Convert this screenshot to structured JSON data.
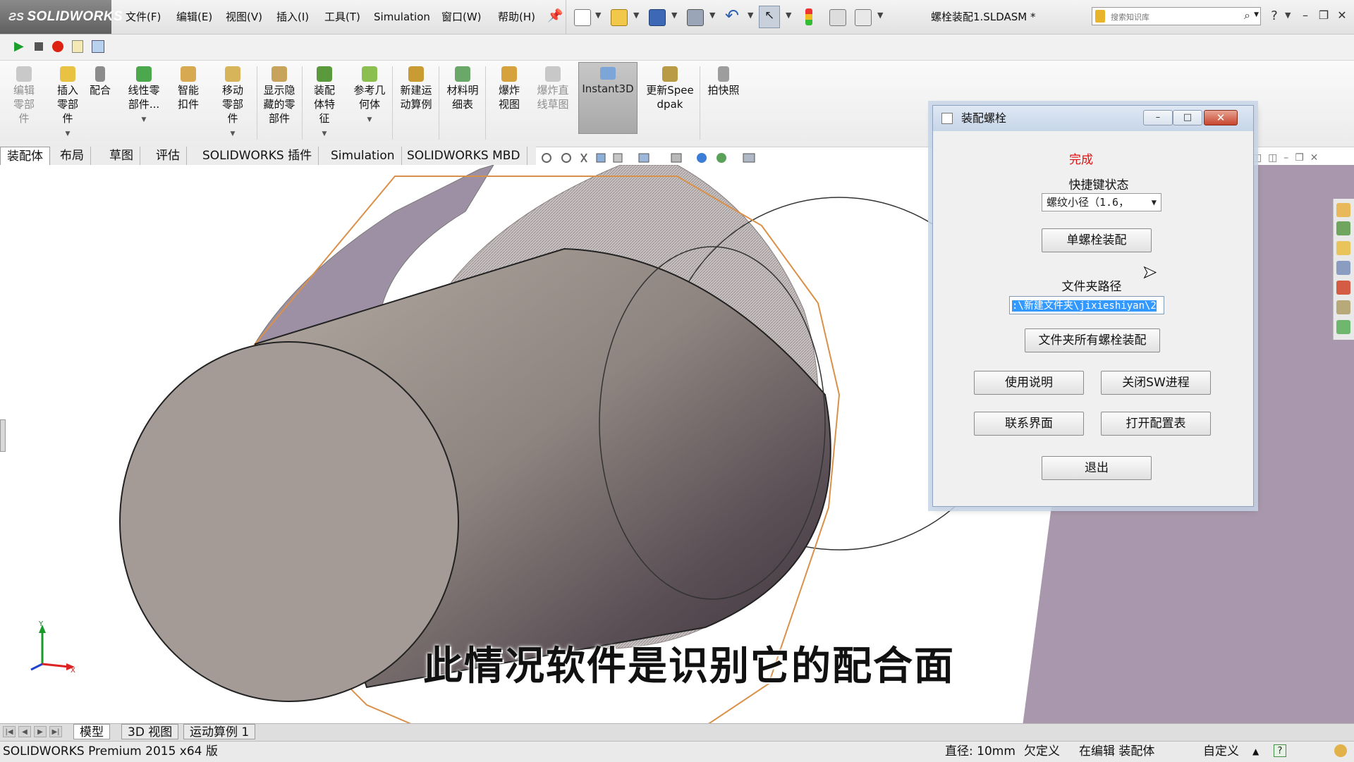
{
  "app": {
    "logo_text": "SOLIDWORKS",
    "document_title": "螺栓装配1.SLDASM *"
  },
  "menu": {
    "items": [
      "文件(F)",
      "编辑(E)",
      "视图(V)",
      "插入(I)",
      "工具(T)",
      "Simulation",
      "窗口(W)",
      "帮助(H)"
    ]
  },
  "search": {
    "placeholder": "搜索知识库"
  },
  "command_manager": {
    "items": [
      {
        "label": "编辑零部件",
        "icon": "edit-component-icon",
        "enabled": false
      },
      {
        "label": "插入零部件",
        "icon": "insert-component-icon",
        "enabled": true,
        "dropdown": true
      },
      {
        "label": "配合",
        "icon": "mate-icon",
        "enabled": true
      },
      {
        "label": "线性零部件...",
        "icon": "linear-pattern-icon",
        "enabled": true,
        "dropdown": true
      },
      {
        "label": "智能扣件",
        "icon": "smart-fastener-icon",
        "enabled": true
      },
      {
        "label": "移动零部件",
        "icon": "move-component-icon",
        "enabled": true,
        "dropdown": true
      },
      {
        "label": "显示隐藏的零部件",
        "icon": "show-hidden-icon",
        "enabled": true
      },
      {
        "label": "装配体特征",
        "icon": "assembly-feature-icon",
        "enabled": true,
        "dropdown": true
      },
      {
        "label": "参考几何体",
        "icon": "reference-geometry-icon",
        "enabled": true,
        "dropdown": true
      },
      {
        "label": "新建运动算例",
        "icon": "new-motion-study-icon",
        "enabled": true
      },
      {
        "label": "材料明细表",
        "icon": "bom-icon",
        "enabled": true
      },
      {
        "label": "爆炸视图",
        "icon": "exploded-view-icon",
        "enabled": true
      },
      {
        "label": "爆炸直线草图",
        "icon": "explode-line-sketch-icon",
        "enabled": false
      },
      {
        "label": "Instant3D",
        "icon": "instant3d-icon",
        "enabled": true,
        "active": true
      },
      {
        "label": "更新Speedpak",
        "icon": "speedpak-icon",
        "enabled": true
      },
      {
        "label": "拍快照",
        "icon": "snapshot-icon",
        "enabled": true
      }
    ]
  },
  "tabs": [
    "装配体",
    "布局",
    "草图",
    "评估",
    "SOLIDWORKS 插件",
    "Simulation",
    "SOLIDWORKS MBD"
  ],
  "active_tab": "装配体",
  "viewport": {
    "caption": "此情况软件是识别它的配合面",
    "triad_x": "X",
    "triad_y": "Y"
  },
  "dialog": {
    "title": "装配螺栓",
    "status": "完成",
    "shortcut_label": "快捷键状态",
    "shortcut_value": "螺纹小径（1.6，",
    "single_bolt_button": "单螺栓装配",
    "folder_label": "文件夹路径",
    "folder_path": ":\\新建文件夹\\jixieshiyan\\2",
    "all_bolts_button": "文件夹所有螺栓装配",
    "help_button": "使用说明",
    "close_sw_button": "关闭SW进程",
    "contact_button": "联系界面",
    "open_config_button": "打开配置表",
    "exit_button": "退出"
  },
  "bottom_tabs": [
    "模型",
    "3D 视图",
    "运动算例 1"
  ],
  "status_bar": {
    "product": "SOLIDWORKS Premium 2015 x64 版",
    "diameter": "直径: 10mm",
    "definition": "欠定义",
    "editing": "在编辑 装配体",
    "units": "自定义"
  },
  "colors": {
    "accent_selection": "#3399ff",
    "status_done": "#dd1111",
    "part_edge_orange": "#d9914a",
    "plate_purple": "#a998ad"
  }
}
